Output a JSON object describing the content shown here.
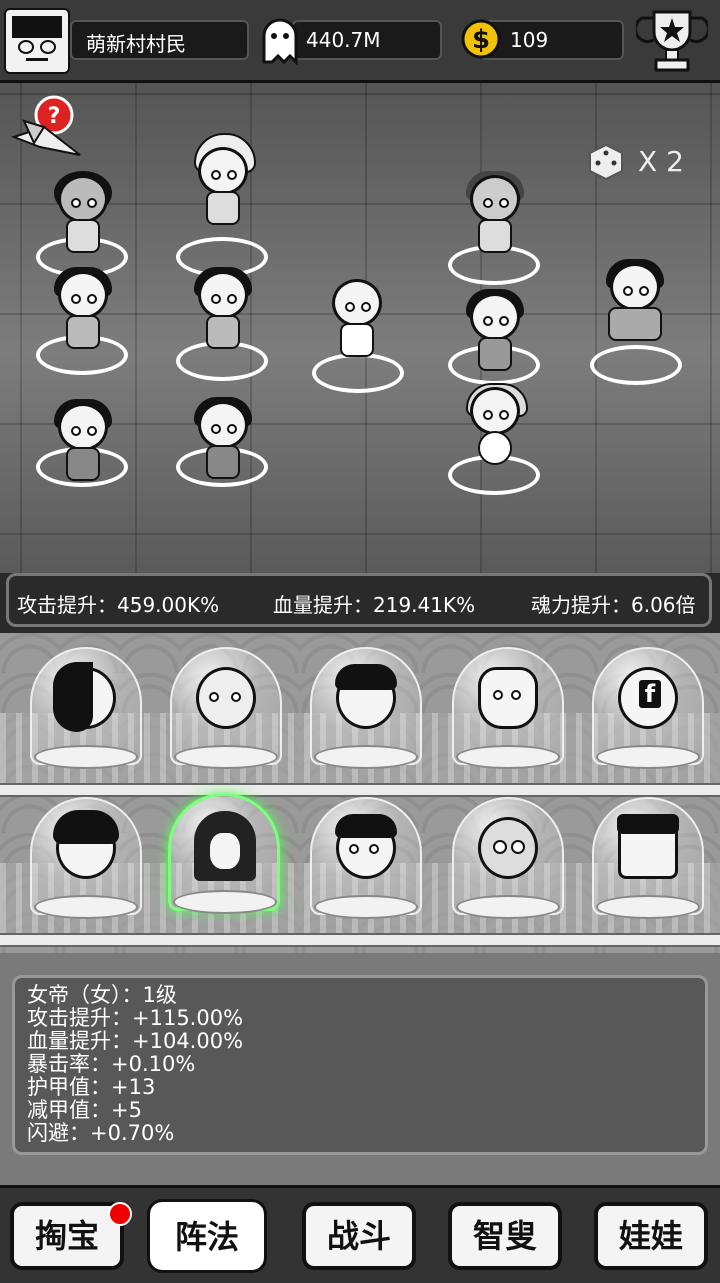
{
  "topbar": {
    "player_name": "萌新村村民",
    "souls": "440.7M",
    "coins": "109"
  },
  "battle": {
    "multiplier": "X 2",
    "stats": {
      "attack": "攻击提升：459.00K%",
      "hp": "血量提升：219.41K%",
      "soul_power": "魂力提升：6.06倍"
    }
  },
  "detail": {
    "lines": [
      "女帝（女）：1级",
      "攻击提升：+115.00%",
      "血量提升：+104.00%",
      "暴击率：+0.10%",
      "护甲值：+13",
      "减甲值：+5",
      "闪避：+0.70%"
    ]
  },
  "nav": {
    "taobao": "掏宝",
    "zhenfa": "阵法",
    "zhandou": "战斗",
    "zhisou": "智叟",
    "wawa": "娃娃"
  }
}
